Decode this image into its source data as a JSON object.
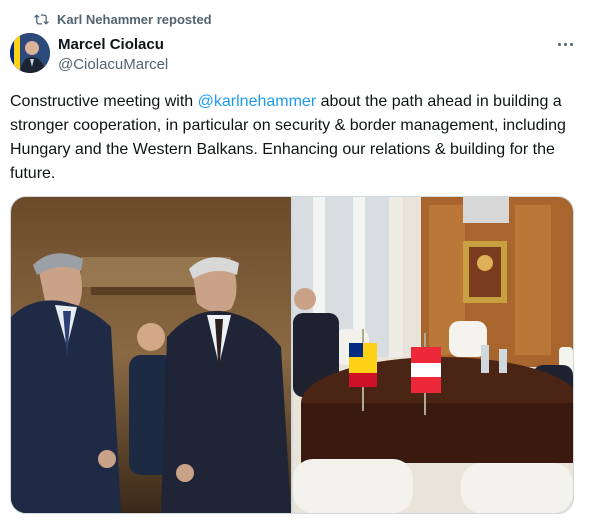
{
  "repost": {
    "text": "Karl Nehammer reposted",
    "icon": "repost-icon"
  },
  "author": {
    "name": "Marcel Ciolacu",
    "handle": "@CiolacuMarcel"
  },
  "tweet": {
    "prefix": "Constructive meeting with ",
    "mention": "@karlnehammer",
    "suffix": " about the path ahead in building a stronger cooperation, in particular on security & border management, including Hungary and the Western Balkans. Enhancing our relations & building for the future."
  },
  "colors": {
    "link": "#1d9bf0",
    "secondary": "#536471",
    "border": "#cfd9de"
  },
  "media": {
    "count": 2,
    "images": [
      {
        "icon": "photo-officials-standing"
      },
      {
        "icon": "photo-meeting-table-flags"
      }
    ]
  }
}
